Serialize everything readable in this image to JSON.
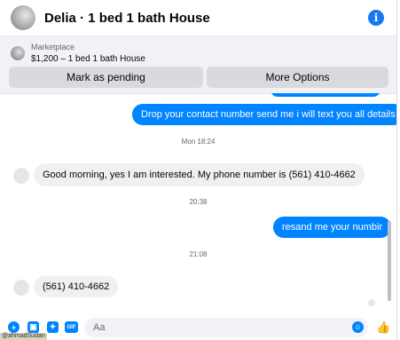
{
  "header": {
    "title": "Delia · 1 bed 1 bath House",
    "info_icon": "info-icon"
  },
  "marketplace": {
    "label": "Marketplace",
    "listing": "$1,200 – 1 bed 1 bath House",
    "pending_button": "Mark as pending",
    "more_button": "More Options"
  },
  "messages": {
    "out_1": "Drop your contact number send me i will text you all details",
    "ts_1": "Mon 18:24",
    "in_1": "Good morning, yes I am interested. My phone number is (561) 410-4662",
    "ts_2": "20:38",
    "out_2": "resand me your numbir",
    "ts_3": "21:08",
    "in_2": "(561) 410-4662"
  },
  "composer": {
    "placeholder": "Aa",
    "gif_label": "GIF",
    "taskbar_fragment": "@ahmadSudan"
  },
  "colors": {
    "accent": "#0084ff",
    "bubble_in": "#f0f0f0",
    "panel": "#f0f2f5"
  }
}
